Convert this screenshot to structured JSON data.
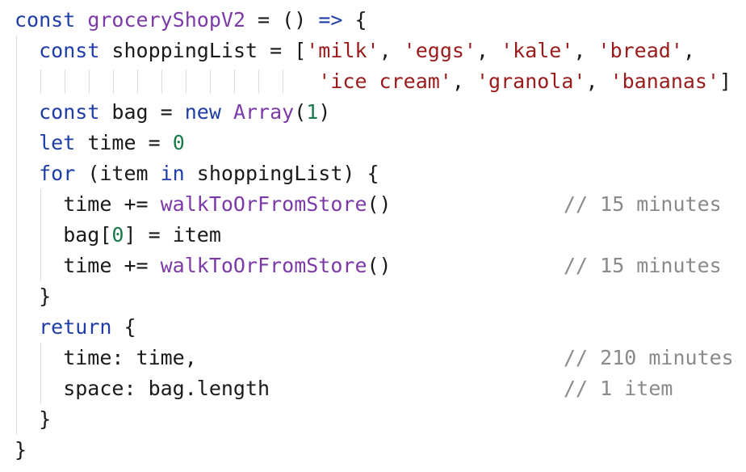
{
  "editor": {
    "lines": [
      {
        "tokens": [
          {
            "t": "kw",
            "v": "const"
          },
          {
            "t": "plain",
            "v": " "
          },
          {
            "t": "fn",
            "v": "groceryShopV2"
          },
          {
            "t": "plain",
            "v": " = () "
          },
          {
            "t": "kw",
            "v": "=>"
          },
          {
            "t": "plain",
            "v": " {"
          }
        ]
      },
      {
        "tokens": [
          {
            "t": "plain",
            "v": "  "
          },
          {
            "t": "kw",
            "v": "const"
          },
          {
            "t": "plain",
            "v": " shoppingList = ["
          },
          {
            "t": "str",
            "v": "'milk'"
          },
          {
            "t": "plain",
            "v": ", "
          },
          {
            "t": "str",
            "v": "'eggs'"
          },
          {
            "t": "plain",
            "v": ", "
          },
          {
            "t": "str",
            "v": "'kale'"
          },
          {
            "t": "plain",
            "v": ", "
          },
          {
            "t": "str",
            "v": "'bread'"
          },
          {
            "t": "plain",
            "v": ","
          }
        ]
      },
      {
        "tokens": [
          {
            "t": "plain",
            "v": "                         "
          },
          {
            "t": "str",
            "v": "'ice cream'"
          },
          {
            "t": "plain",
            "v": ", "
          },
          {
            "t": "str",
            "v": "'granola'"
          },
          {
            "t": "plain",
            "v": ", "
          },
          {
            "t": "str",
            "v": "'bananas'"
          },
          {
            "t": "plain",
            "v": "]"
          }
        ]
      },
      {
        "tokens": [
          {
            "t": "plain",
            "v": "  "
          },
          {
            "t": "kw",
            "v": "const"
          },
          {
            "t": "plain",
            "v": " bag = "
          },
          {
            "t": "kw",
            "v": "new"
          },
          {
            "t": "plain",
            "v": " "
          },
          {
            "t": "fn",
            "v": "Array"
          },
          {
            "t": "plain",
            "v": "("
          },
          {
            "t": "num",
            "v": "1"
          },
          {
            "t": "plain",
            "v": ")"
          }
        ]
      },
      {
        "tokens": [
          {
            "t": "plain",
            "v": "  "
          },
          {
            "t": "kw",
            "v": "let"
          },
          {
            "t": "plain",
            "v": " time = "
          },
          {
            "t": "num",
            "v": "0"
          }
        ]
      },
      {
        "tokens": [
          {
            "t": "plain",
            "v": "  "
          },
          {
            "t": "kw",
            "v": "for"
          },
          {
            "t": "plain",
            "v": " (item "
          },
          {
            "t": "kw",
            "v": "in"
          },
          {
            "t": "plain",
            "v": " shoppingList) {"
          }
        ]
      },
      {
        "tokens": [
          {
            "t": "plain",
            "v": "    time += "
          },
          {
            "t": "fn",
            "v": "walkToOrFromStore"
          },
          {
            "t": "plain",
            "v": "()"
          }
        ],
        "comment": "// 15 minutes"
      },
      {
        "tokens": [
          {
            "t": "plain",
            "v": "    bag["
          },
          {
            "t": "num",
            "v": "0"
          },
          {
            "t": "plain",
            "v": "] = item"
          }
        ]
      },
      {
        "tokens": [
          {
            "t": "plain",
            "v": "    time += "
          },
          {
            "t": "fn",
            "v": "walkToOrFromStore"
          },
          {
            "t": "plain",
            "v": "()"
          }
        ],
        "comment": "// 15 minutes"
      },
      {
        "tokens": [
          {
            "t": "plain",
            "v": "  }"
          }
        ]
      },
      {
        "tokens": [
          {
            "t": "plain",
            "v": "  "
          },
          {
            "t": "kw",
            "v": "return"
          },
          {
            "t": "plain",
            "v": " {"
          }
        ]
      },
      {
        "tokens": [
          {
            "t": "plain",
            "v": "    time: time,"
          }
        ],
        "comment": "// 210 minutes"
      },
      {
        "tokens": [
          {
            "t": "plain",
            "v": "    space: bag.length"
          }
        ],
        "comment": "// 1 item"
      },
      {
        "tokens": [
          {
            "t": "plain",
            "v": "  }"
          }
        ]
      },
      {
        "tokens": [
          {
            "t": "plain",
            "v": "}"
          }
        ]
      }
    ]
  },
  "colors": {
    "keyword": "#1f3da8",
    "function": "#7c3aa8",
    "string": "#9a1b1b",
    "number": "#1a7a4a",
    "comment": "#8a8a8a",
    "indent_guide": "#dcdcdc"
  }
}
